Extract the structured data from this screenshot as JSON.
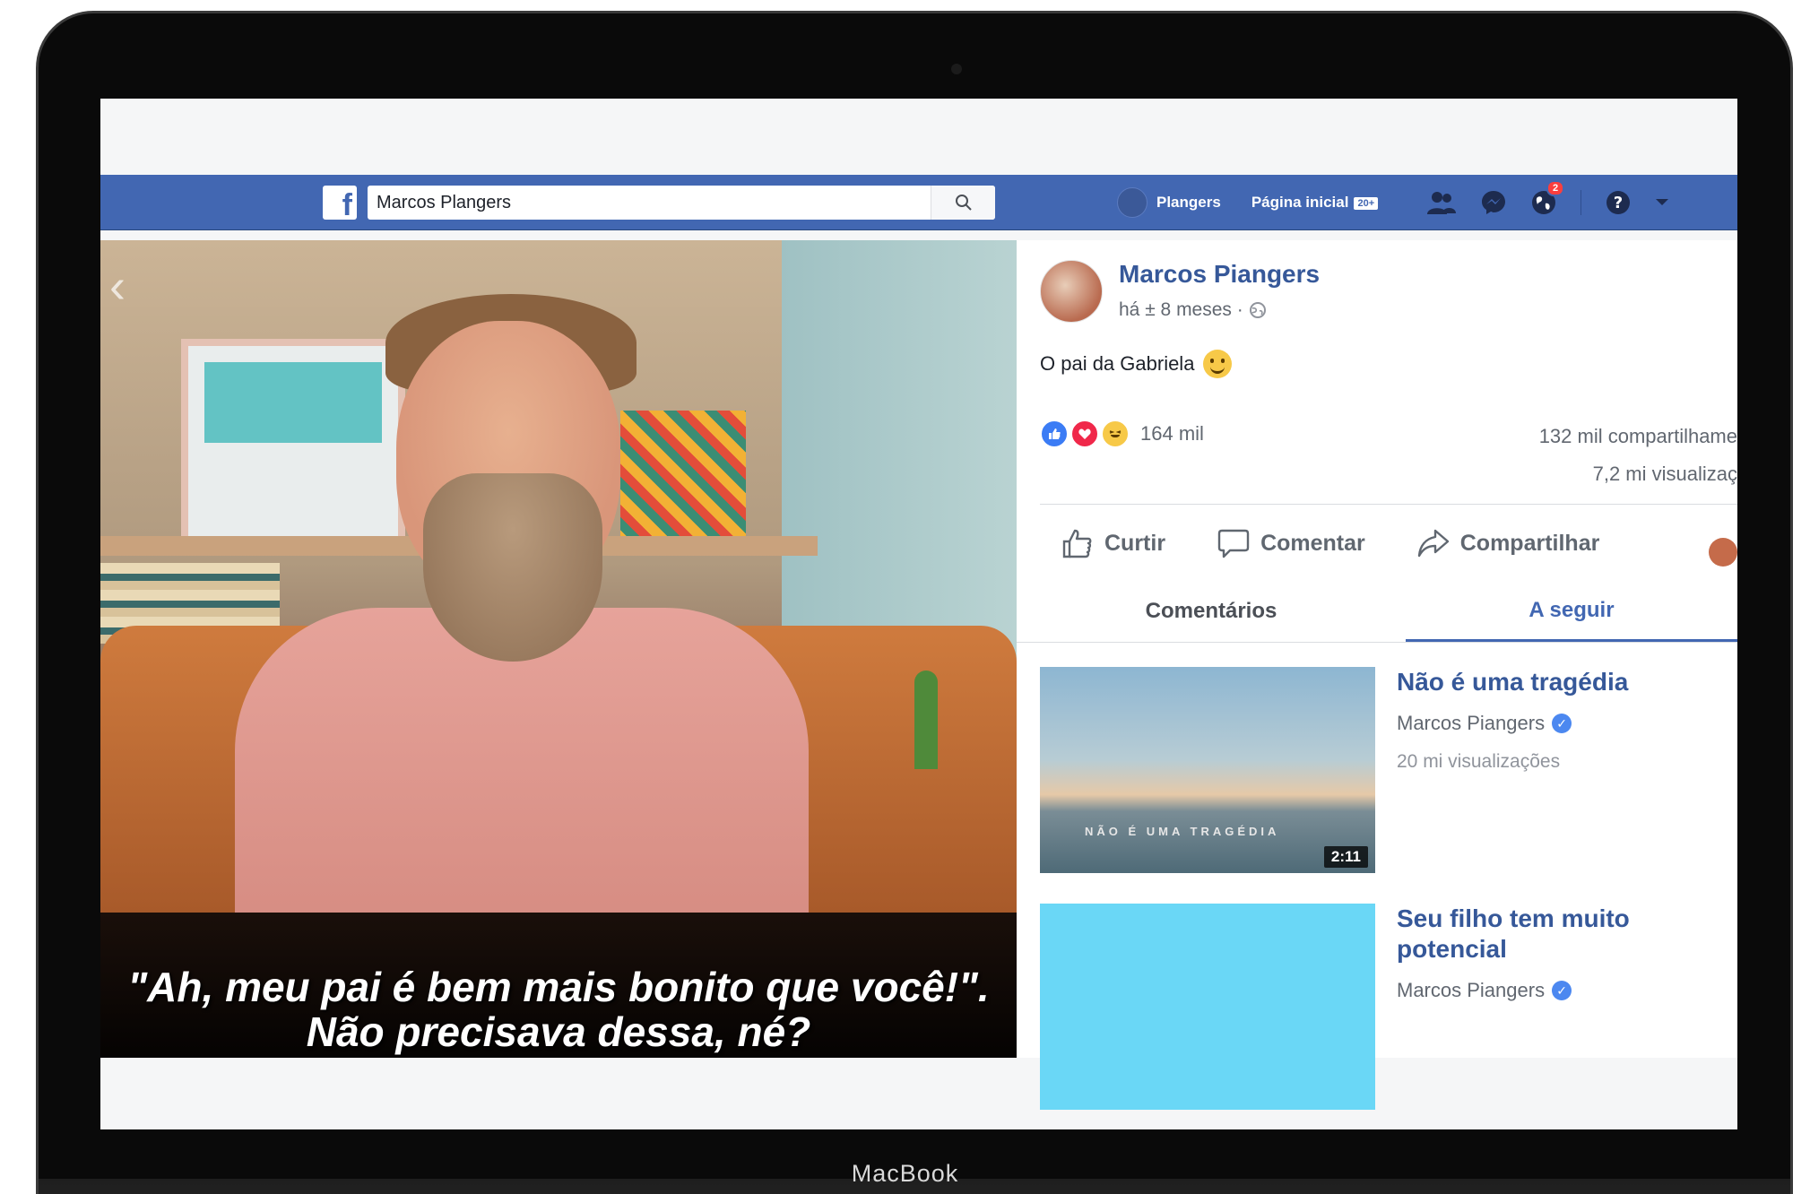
{
  "device": {
    "brand": "MacBook"
  },
  "topbar": {
    "search_value": "Marcos Plangers",
    "profile_name": "Plangers",
    "home_label": "Página inicial",
    "home_badge": "20+",
    "notification_count": "2"
  },
  "video": {
    "subtitle_line1": "\"Ah, meu pai é bem mais bonito que você!\".",
    "subtitle_line2": "Não precisava dessa, né?"
  },
  "post": {
    "author": "Marcos Piangers",
    "time": "há ± 8 meses ·",
    "text": "O pai da Gabriela",
    "reaction_count": "164 mil",
    "shares": "132 mil compartilhame",
    "views": "7,2 mi visualizaç",
    "actions": {
      "like": "Curtir",
      "comment": "Comentar",
      "share": "Compartilhar"
    }
  },
  "tabs": {
    "comments": "Comentários",
    "up_next": "A seguir"
  },
  "up_next": [
    {
      "title": "Não é uma tragédia",
      "author": "Marcos Piangers",
      "views": "20 mi visualizações",
      "thumb_caption": "NÃO É UMA TRAGÉDIA",
      "duration": "2:11"
    },
    {
      "title": "Seu filho tem muito potencial",
      "author": "Marcos Piangers"
    }
  ],
  "colors": {
    "facebook_blue": "#4267b2",
    "link_blue": "#365899",
    "thumb_cyan": "#6ad7f6"
  }
}
